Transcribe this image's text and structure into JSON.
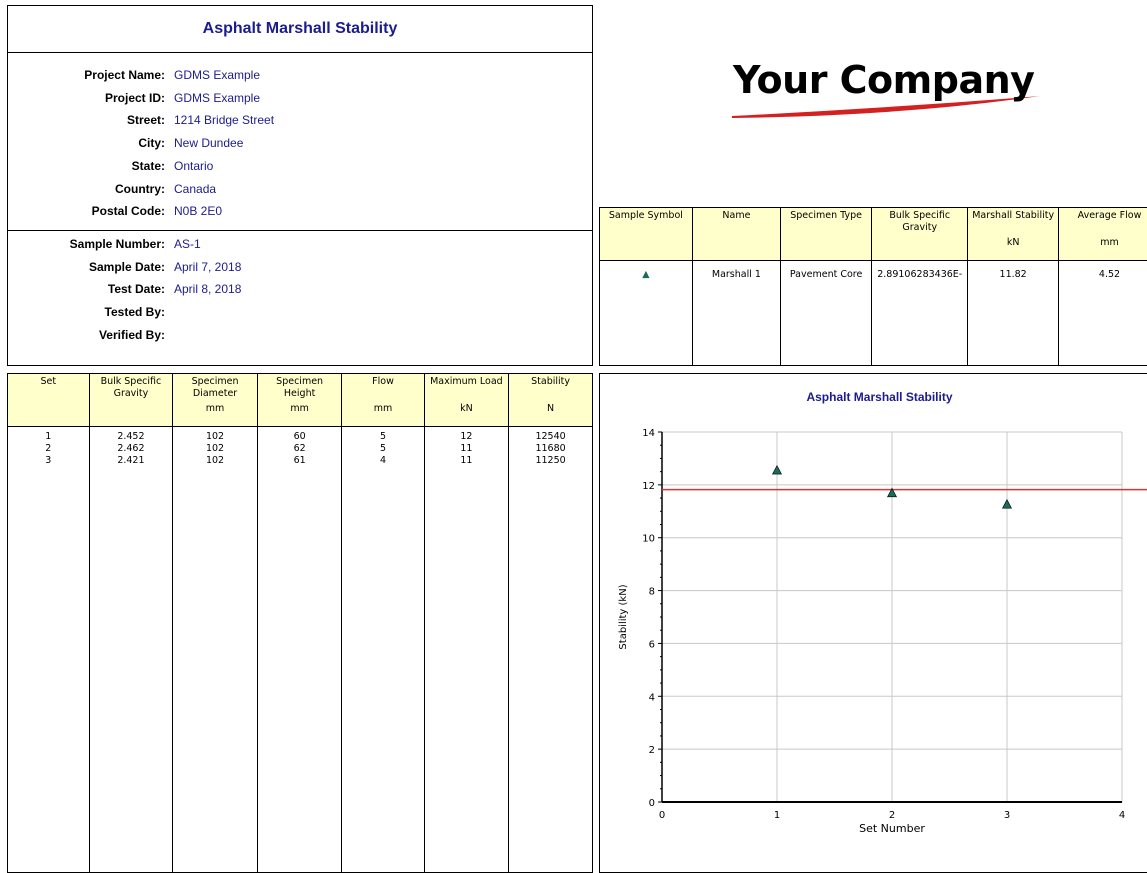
{
  "header": {
    "title": "Asphalt Marshall Stability"
  },
  "project": [
    {
      "label": "Project Name:",
      "value": "GDMS Example"
    },
    {
      "label": "Project ID:",
      "value": "GDMS Example"
    },
    {
      "label": "Street:",
      "value": "1214 Bridge Street"
    },
    {
      "label": "City:",
      "value": "New Dundee"
    },
    {
      "label": "State:",
      "value": "Ontario"
    },
    {
      "label": "Country:",
      "value": "Canada"
    },
    {
      "label": "Postal Code:",
      "value": "N0B 2E0"
    }
  ],
  "sample": [
    {
      "label": "Sample Number:",
      "value": "AS-1"
    },
    {
      "label": "Sample Date:",
      "value": "April 7, 2018"
    },
    {
      "label": "Test Date:",
      "value": "April 8, 2018"
    },
    {
      "label": "Tested By:",
      "value": ""
    },
    {
      "label": "Verified By:",
      "value": ""
    }
  ],
  "logo": {
    "text": "Your Company"
  },
  "summary_table": {
    "columns": [
      {
        "label": "Sample Symbol",
        "unit": ""
      },
      {
        "label": "Name",
        "unit": ""
      },
      {
        "label": "Specimen Type",
        "unit": ""
      },
      {
        "label": "Bulk Specific Gravity",
        "unit": ""
      },
      {
        "label": "Marshall Stability",
        "unit": "kN"
      },
      {
        "label": "Average Flow",
        "unit": "mm"
      }
    ],
    "row": {
      "symbol": "▲",
      "name": "Marshall 1",
      "type": "Pavement Core",
      "bsg": "2.89106283436E-",
      "stability": "11.82",
      "flow": "4.52"
    },
    "symbol_color": "#1a6b5a"
  },
  "data_table": {
    "columns": [
      {
        "label": "Set",
        "unit": ""
      },
      {
        "label": "Bulk Specific Gravity",
        "unit": ""
      },
      {
        "label": "Specimen Diameter",
        "unit": "mm"
      },
      {
        "label": "Specimen Height",
        "unit": "mm"
      },
      {
        "label": "Flow",
        "unit": "mm"
      },
      {
        "label": "Maximum Load",
        "unit": "kN"
      },
      {
        "label": "Stability",
        "unit": "N"
      }
    ],
    "rows": [
      [
        "1",
        "2.452",
        "102",
        "60",
        "5",
        "12",
        "12540"
      ],
      [
        "2",
        "2.462",
        "102",
        "62",
        "5",
        "11",
        "11680"
      ],
      [
        "3",
        "2.421",
        "102",
        "61",
        "4",
        "11",
        "11250"
      ]
    ]
  },
  "chart_data": {
    "type": "scatter",
    "title": "Asphalt Marshall Stability",
    "xlabel": "Set Number",
    "ylabel": "Stability (kN)",
    "xlim": [
      0,
      4
    ],
    "ylim": [
      0,
      14
    ],
    "xticks": [
      "0",
      "1",
      "2",
      "3",
      "4"
    ],
    "yticks": [
      "0",
      "2",
      "4",
      "6",
      "8",
      "10",
      "12",
      "14"
    ],
    "grid": true,
    "series": [
      {
        "x": [
          1,
          2,
          3
        ],
        "y": [
          12.54,
          11.68,
          11.25
        ],
        "marker": "triangle",
        "color": "#1a6b5a"
      }
    ],
    "hline": {
      "y": 11.82,
      "color": "#e03030"
    }
  }
}
